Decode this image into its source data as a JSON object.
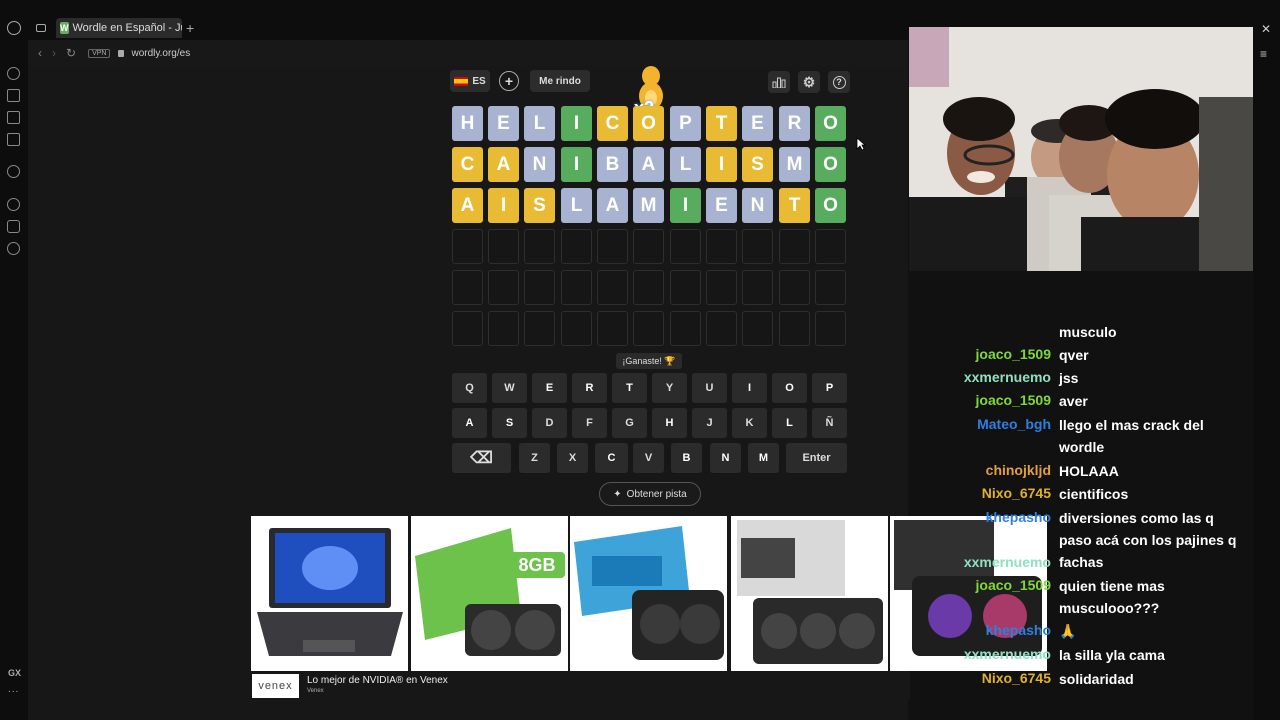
{
  "browser": {
    "tab_title": "Wordle en Español - Jueg",
    "tab_favicon": "W",
    "new_tab": "+",
    "vpn": "VPN",
    "url": "wordly.org/es",
    "sidebar_gx": "GX",
    "sidebar_more": "..."
  },
  "wordle": {
    "lang": "ES",
    "give_up": "Me rindo",
    "mascot_badge": "x2",
    "board": [
      {
        "letters": [
          "H",
          "E",
          "L",
          "I",
          "C",
          "O",
          "P",
          "T",
          "E",
          "R",
          "O"
        ],
        "states": [
          "b",
          "b",
          "b",
          "g",
          "y",
          "y",
          "b",
          "y",
          "b",
          "b",
          "g"
        ]
      },
      {
        "letters": [
          "C",
          "A",
          "N",
          "I",
          "B",
          "A",
          "L",
          "I",
          "S",
          "M",
          "O"
        ],
        "states": [
          "y",
          "y",
          "b",
          "g",
          "b",
          "b",
          "b",
          "y",
          "y",
          "b",
          "g"
        ]
      },
      {
        "letters": [
          "A",
          "I",
          "S",
          "L",
          "A",
          "M",
          "I",
          "E",
          "N",
          "T",
          "O"
        ],
        "states": [
          "y",
          "y",
          "y",
          "b",
          "b",
          "b",
          "g",
          "b",
          "b",
          "y",
          "g"
        ]
      },
      {
        "letters": [
          "",
          "",
          "",
          "",
          "",
          "",
          "",
          "",
          "",
          "",
          ""
        ],
        "states": [
          "e",
          "e",
          "e",
          "e",
          "e",
          "e",
          "e",
          "e",
          "e",
          "e",
          "e"
        ]
      },
      {
        "letters": [
          "",
          "",
          "",
          "",
          "",
          "",
          "",
          "",
          "",
          "",
          ""
        ],
        "states": [
          "e",
          "e",
          "e",
          "e",
          "e",
          "e",
          "e",
          "e",
          "e",
          "e",
          "e"
        ]
      },
      {
        "letters": [
          "",
          "",
          "",
          "",
          "",
          "",
          "",
          "",
          "",
          "",
          ""
        ],
        "states": [
          "e",
          "e",
          "e",
          "e",
          "e",
          "e",
          "e",
          "e",
          "e",
          "e",
          "e"
        ]
      }
    ],
    "status": "¡Ganaste! 🏆",
    "keyboard": [
      [
        {
          "k": "Q",
          "s": "n"
        },
        {
          "k": "W",
          "s": "n"
        },
        {
          "k": "E",
          "s": "b"
        },
        {
          "k": "R",
          "s": "b"
        },
        {
          "k": "T",
          "s": "y"
        },
        {
          "k": "Y",
          "s": "n"
        },
        {
          "k": "U",
          "s": "n"
        },
        {
          "k": "I",
          "s": "g"
        },
        {
          "k": "O",
          "s": "g"
        },
        {
          "k": "P",
          "s": "b"
        }
      ],
      [
        {
          "k": "A",
          "s": "y"
        },
        {
          "k": "S",
          "s": "y"
        },
        {
          "k": "D",
          "s": "n"
        },
        {
          "k": "F",
          "s": "n"
        },
        {
          "k": "G",
          "s": "n"
        },
        {
          "k": "H",
          "s": "b"
        },
        {
          "k": "J",
          "s": "n"
        },
        {
          "k": "K",
          "s": "n"
        },
        {
          "k": "L",
          "s": "b"
        },
        {
          "k": "Ñ",
          "s": "n"
        }
      ],
      [
        {
          "k": "⌫",
          "s": "n"
        },
        {
          "k": "Z",
          "s": "n"
        },
        {
          "k": "X",
          "s": "n"
        },
        {
          "k": "C",
          "s": "y"
        },
        {
          "k": "V",
          "s": "n"
        },
        {
          "k": "B",
          "s": "b"
        },
        {
          "k": "N",
          "s": "b"
        },
        {
          "k": "M",
          "s": "b"
        },
        {
          "k": "Enter",
          "s": "n"
        }
      ]
    ],
    "hint": "Obtener pista"
  },
  "ad": {
    "logo": "venex",
    "title": "Lo mejor de NVIDIA® en Venex",
    "subtitle": "Venex",
    "products": [
      "laptop",
      "gpu-galax-8gb",
      "gpu-gigabyte",
      "gpu-asus-prime",
      "gpu-rgb"
    ],
    "badge_8gb": "8GB"
  },
  "chat": [
    {
      "user": "",
      "msg": "musculo",
      "color": "#ffffff"
    },
    {
      "user": "joaco_1509",
      "msg": "qver",
      "color": "#7fd83a"
    },
    {
      "user": "xxmernuemo",
      "msg": "jss",
      "color": "#8fe0c0"
    },
    {
      "user": "joaco_1509",
      "msg": "aver",
      "color": "#7fd83a"
    },
    {
      "user": "Mateo_bgh",
      "msg": "llego el mas crack del wordle",
      "color": "#2e7fe0"
    },
    {
      "user": "chinojkljd",
      "msg": "HOLAAA",
      "color": "#e0a040"
    },
    {
      "user": "Nixo_6745",
      "msg": "cientificos",
      "color": "#e0b030"
    },
    {
      "user": "khepasho",
      "msg": "diversiones como las q paso acá con los pajines q fachas",
      "color": "#2e7fe0"
    },
    {
      "user": "xxmernuemo",
      "msg": "",
      "color": "#8fe0c0"
    },
    {
      "user": "joaco_1509",
      "msg": "quien tiene mas musculooo???",
      "color": "#7fd83a"
    },
    {
      "user": "khepasho",
      "msg": "🙏",
      "color": "#2e7fe0"
    },
    {
      "user": "xxmernuemo",
      "msg": "la silla yla cama",
      "color": "#8fe0c0"
    },
    {
      "user": "Nixo_6745",
      "msg": "solidaridad",
      "color": "#e0b030"
    }
  ]
}
